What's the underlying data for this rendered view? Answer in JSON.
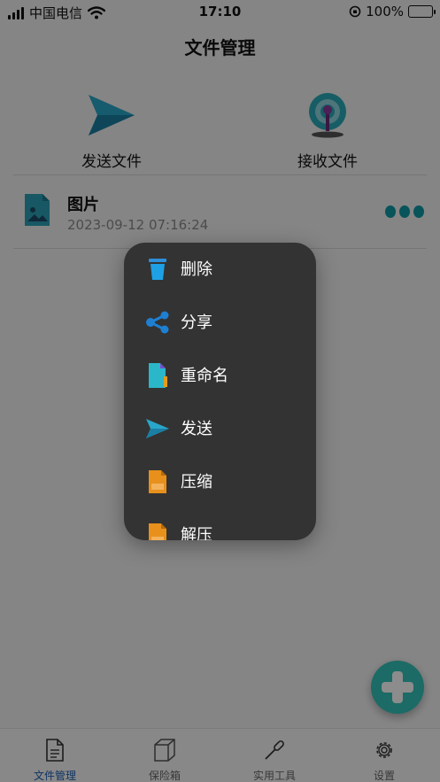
{
  "status_bar": {
    "carrier": "中国电信",
    "time": "17:10",
    "battery_percent": "100%",
    "icons": [
      "signal-icon",
      "wifi-icon",
      "orientation-lock-icon",
      "battery-charging-icon"
    ]
  },
  "header": {
    "title": "文件管理"
  },
  "actions": {
    "send_label": "发送文件",
    "receive_label": "接收文件",
    "send_icon": "paper-plane-icon",
    "receive_icon": "antenna-icon"
  },
  "file": {
    "name": "图片",
    "date": "2023-09-12 07:16:24",
    "icon": "image-file-icon",
    "more_icon": "more-dots-icon"
  },
  "context_menu": {
    "items": [
      {
        "label": "删除",
        "icon": "trash-icon"
      },
      {
        "label": "分享",
        "icon": "share-icon"
      },
      {
        "label": "重命名",
        "icon": "rename-icon"
      },
      {
        "label": "发送",
        "icon": "send-icon"
      },
      {
        "label": "压缩",
        "icon": "zip-icon"
      },
      {
        "label": "解压",
        "icon": "unzip-icon"
      }
    ]
  },
  "fab": {
    "icon": "plus-icon"
  },
  "tabs": [
    {
      "label": "文件管理",
      "icon": "document-icon",
      "active": true
    },
    {
      "label": "保险箱",
      "icon": "box-icon",
      "active": false
    },
    {
      "label": "实用工具",
      "icon": "screwdriver-icon",
      "active": false
    },
    {
      "label": "设置",
      "icon": "gear-icon",
      "active": false
    }
  ],
  "colors": {
    "accent": "#1a5fb4",
    "teal": "#0d9aa4",
    "menu_bg": "#333333",
    "fab": "#33c3bb",
    "battery": "#35c759"
  }
}
